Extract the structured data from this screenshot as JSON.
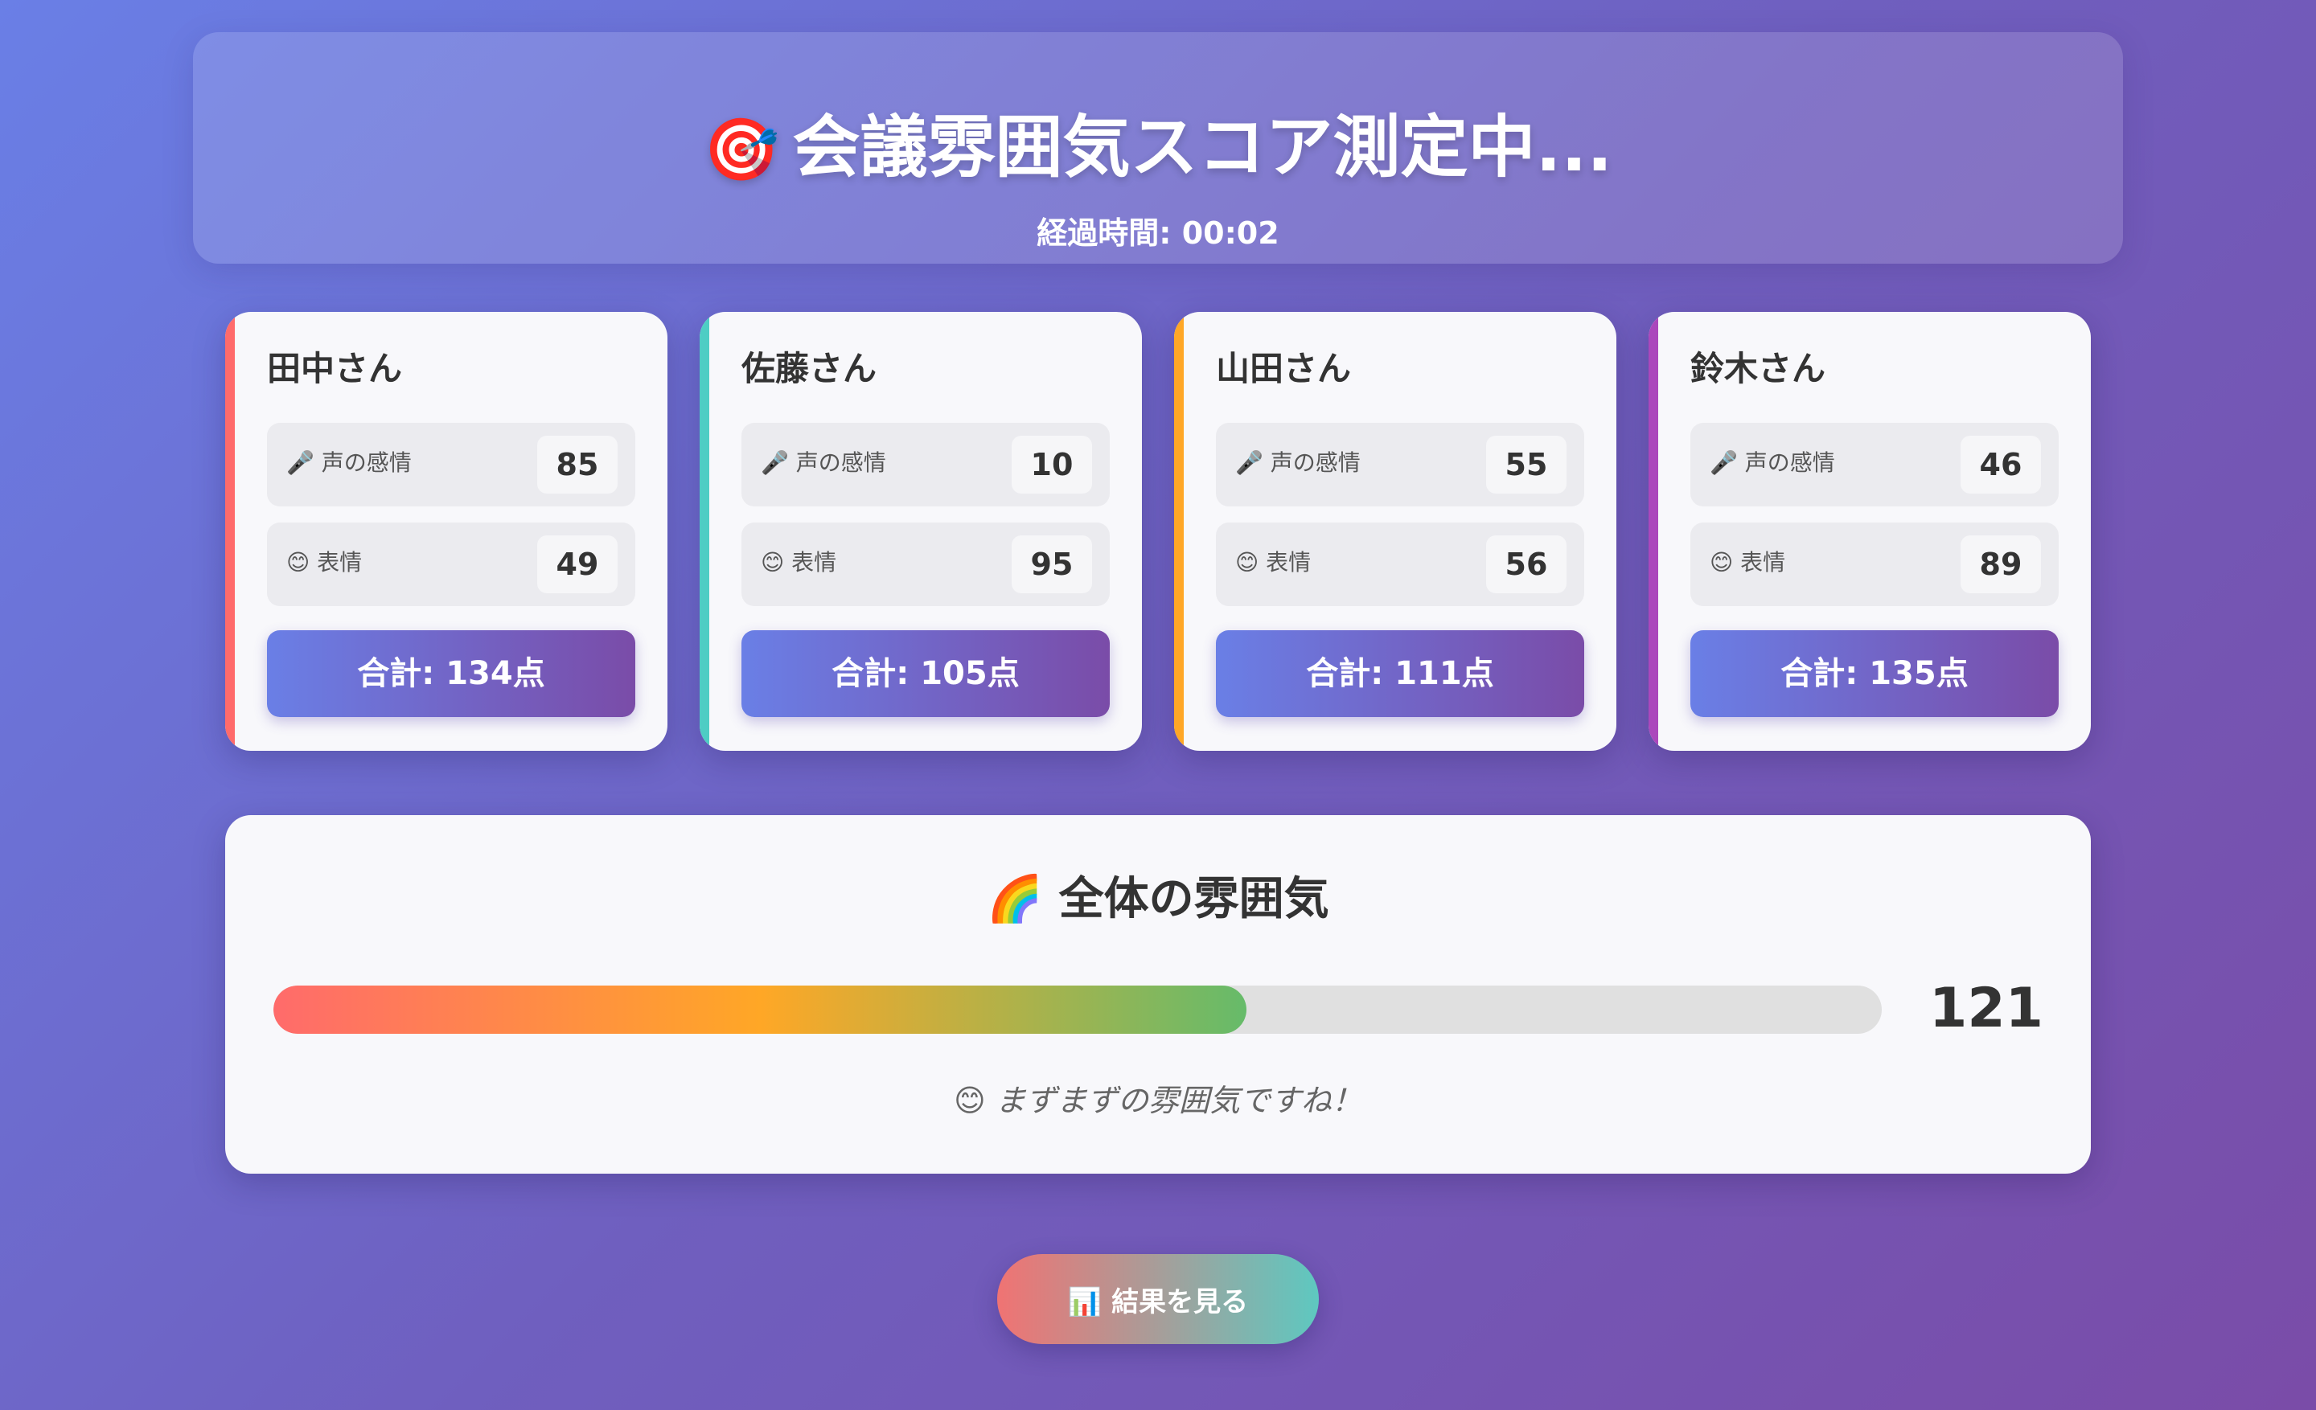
{
  "header": {
    "icon": "🎯",
    "icon_name": "target-icon",
    "title": "会議雰囲気スコア測定中...",
    "elapsed_label": "経過時間: 00:02"
  },
  "participants": [
    {
      "name": "田中さん",
      "color": "#ff6b6b",
      "voice_label": "🎤 声の感情",
      "voice": "85",
      "face_label": "😊 表情",
      "face": "49",
      "total": "合計: 134点"
    },
    {
      "name": "佐藤さん",
      "color": "#4ecdc4",
      "voice_label": "🎤 声の感情",
      "voice": "10",
      "face_label": "😊 表情",
      "face": "95",
      "total": "合計: 105点"
    },
    {
      "name": "山田さん",
      "color": "#ffa726",
      "voice_label": "🎤 声の感情",
      "voice": "55",
      "face_label": "😊 表情",
      "face": "56",
      "total": "合計: 111点"
    },
    {
      "name": "鈴木さん",
      "color": "#ab47bc",
      "voice_label": "🎤 声の感情",
      "voice": "46",
      "face_label": "😊 表情",
      "face": "89",
      "total": "合計: 135点"
    }
  ],
  "overall": {
    "title": "🌈 全体の雰囲気",
    "score": "121",
    "progress_percent": 60.5,
    "message": "😊 まずまずの雰囲気ですね！"
  },
  "actions": {
    "result_button": "📊 結果を見る"
  },
  "colors": {
    "card_gradient_start": "#6a7fe6",
    "card_gradient_end": "#7a4ca8"
  }
}
